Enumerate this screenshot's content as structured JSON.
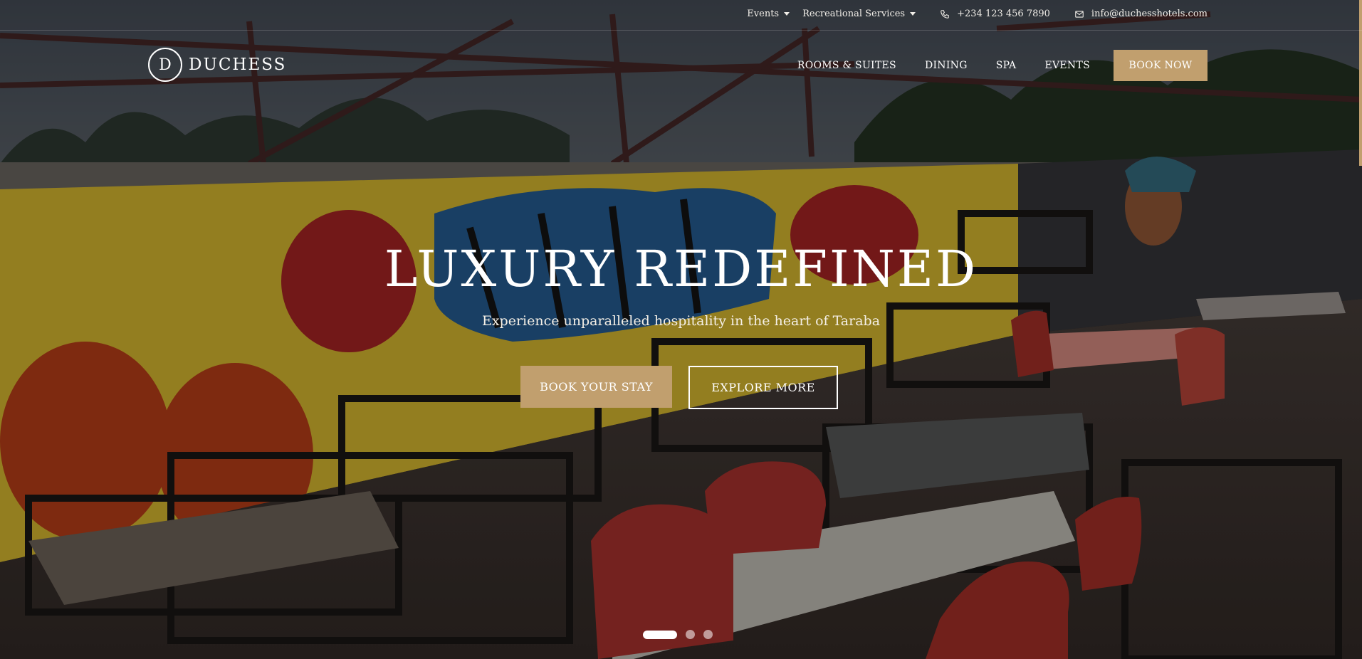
{
  "topbar": {
    "items": [
      {
        "label": "Events",
        "icon": "chevron-down-icon"
      },
      {
        "label": "Recreational Services",
        "icon": "chevron-down-icon"
      }
    ],
    "phone": {
      "icon": "phone-icon",
      "text": "+234 123 456 7890"
    },
    "email": {
      "icon": "mail-icon",
      "text": "info@duchesshotels.com"
    }
  },
  "brand": {
    "initial": "D",
    "name": "DUCHESS"
  },
  "nav": {
    "links": [
      "ROOMS & SUITES",
      "DINING",
      "SPA",
      "EVENTS"
    ],
    "cta": "BOOK NOW"
  },
  "hero": {
    "headline": "LUXURY REDEFINED",
    "subheadline": "Experience unparalleled hospitality in the heart of Taraba",
    "primary_button": "BOOK YOUR STAY",
    "secondary_button": "EXPLORE MORE",
    "slides_total": 3,
    "active_slide": 1
  },
  "colors": {
    "accent": "#c19f6e",
    "text": "#ffffff"
  }
}
